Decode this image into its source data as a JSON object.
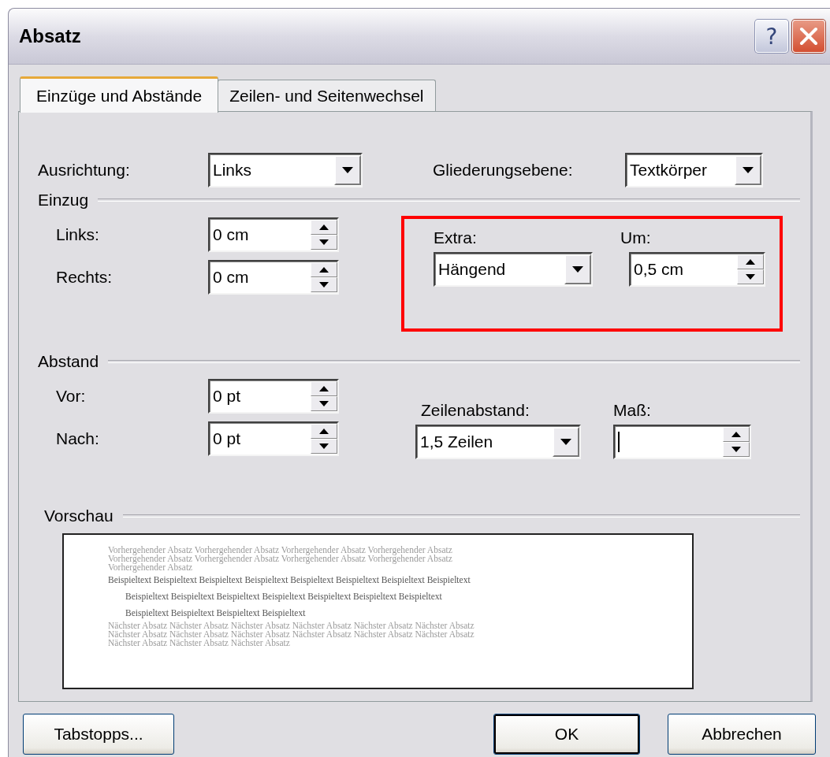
{
  "window": {
    "title": "Absatz",
    "help_label": "?"
  },
  "tabs": [
    {
      "label": "Einzüge und Abstände",
      "selected": true
    },
    {
      "label": "Zeilen- und Seitenwechsel",
      "selected": false
    }
  ],
  "general": {
    "alignment": {
      "label": "Ausrichtung:",
      "value": "Links"
    },
    "outline_level": {
      "label": "Gliederungsebene:",
      "value": "Textkörper"
    }
  },
  "indent": {
    "heading": "Einzug",
    "highlighted": true,
    "left": {
      "label": "Links:",
      "value": "0 cm"
    },
    "right": {
      "label": "Rechts:",
      "value": "0 cm"
    },
    "special": {
      "label": "Extra:",
      "value": "Hängend"
    },
    "by": {
      "label": "Um:",
      "value": "0,5 cm"
    }
  },
  "spacing": {
    "heading": "Abstand",
    "before": {
      "label": "Vor:",
      "value": "0 pt"
    },
    "after": {
      "label": "Nach:",
      "value": "0 pt"
    },
    "line_spacing": {
      "label": "Zeilenabstand:",
      "value": "1,5 Zeilen"
    },
    "at": {
      "label": "Maß:",
      "focused": true
    }
  },
  "preview": {
    "heading": "Vorschau",
    "lines": [
      {
        "kind": "previous",
        "text": "Vorhergehender Absatz Vorhergehender Absatz Vorhergehender Absatz Vorhergehender Absatz"
      },
      {
        "kind": "previous",
        "text": "Vorhergehender Absatz Vorhergehender Absatz Vorhergehender Absatz Vorhergehender Absatz"
      },
      {
        "kind": "previous",
        "text": "Vorhergehender Absatz"
      },
      {
        "kind": "first",
        "text": "Beispieltext Beispieltext Beispieltext Beispieltext Beispieltext Beispieltext Beispieltext Beispieltext"
      },
      {
        "kind": "hanging",
        "text": "Beispieltext Beispieltext Beispieltext Beispieltext Beispieltext Beispieltext Beispieltext"
      },
      {
        "kind": "hanging",
        "text": "Beispieltext Beispieltext Beispieltext Beispieltext"
      },
      {
        "kind": "next",
        "text": "Nächster Absatz Nächster Absatz Nächster Absatz Nächster Absatz Nächster Absatz Nächster Absatz"
      },
      {
        "kind": "next",
        "text": "Nächster Absatz Nächster Absatz Nächster Absatz Nächster Absatz Nächster Absatz Nächster Absatz"
      },
      {
        "kind": "next",
        "text": "Nächster Absatz Nächster Absatz Nächster Absatz"
      }
    ]
  },
  "buttons": [
    {
      "label": "Tabstopps...",
      "default": false
    },
    {
      "label": "OK",
      "default": true
    },
    {
      "label": "Abbrechen",
      "default": false
    }
  ]
}
